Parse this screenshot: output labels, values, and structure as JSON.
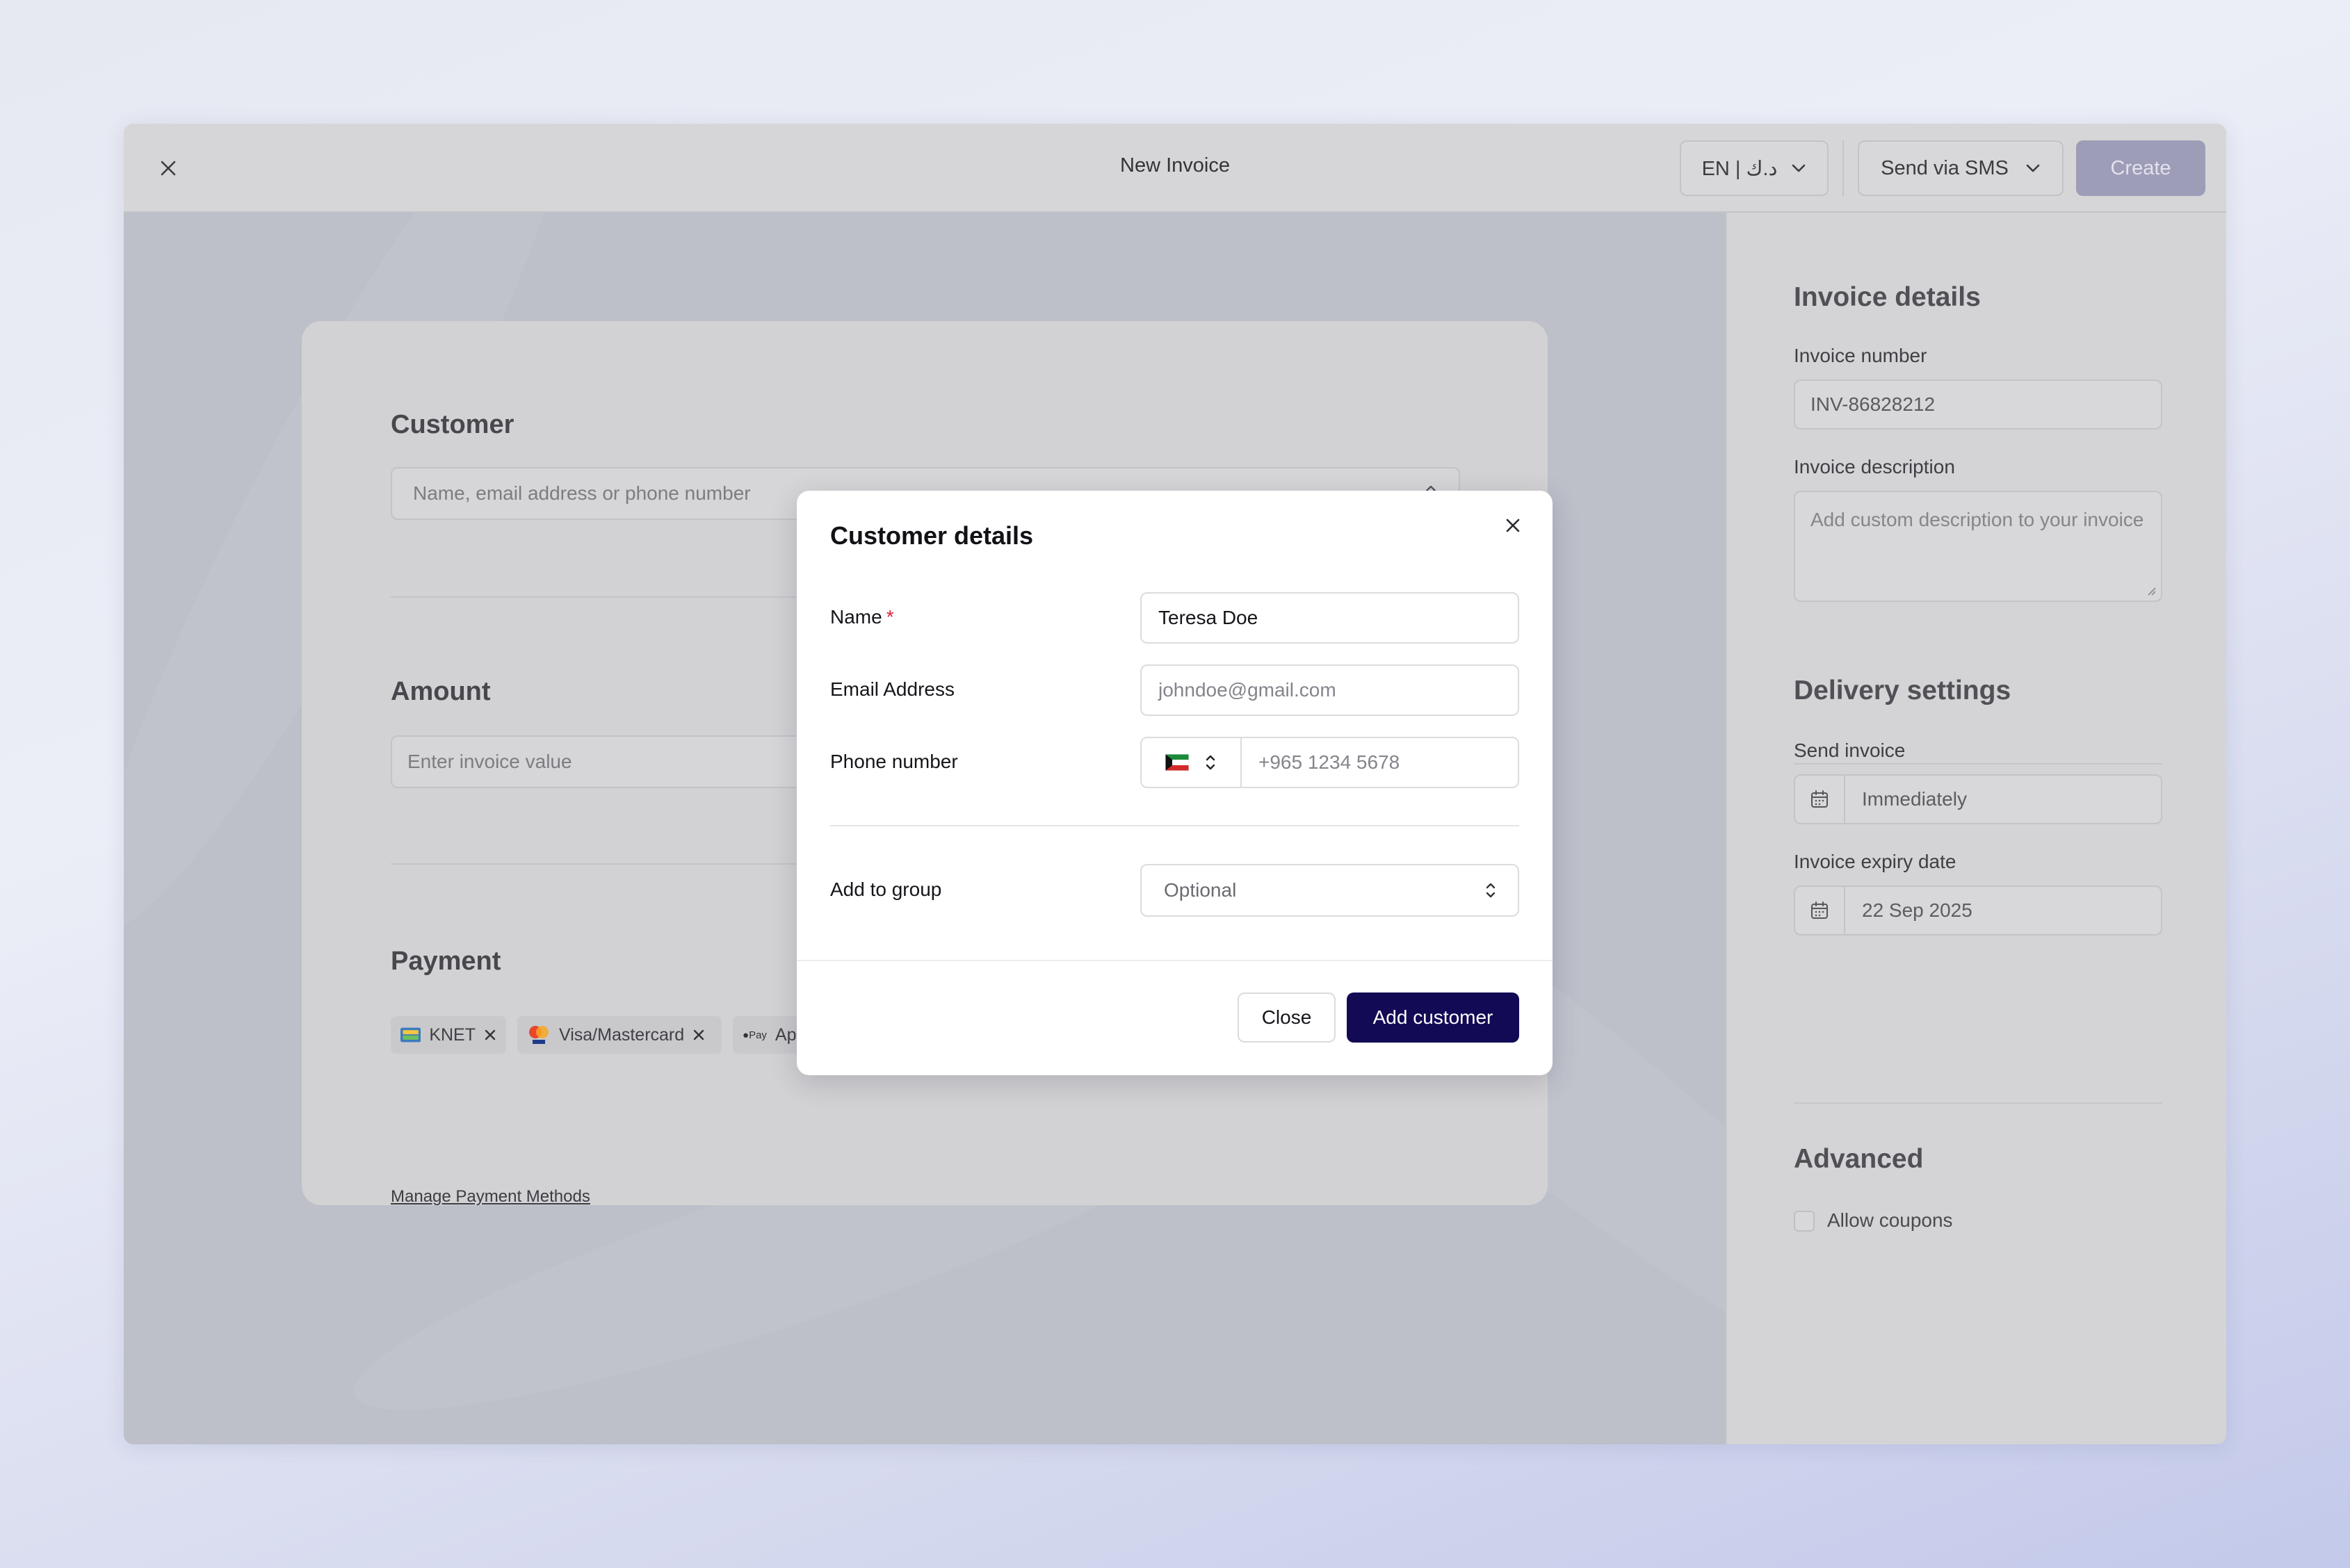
{
  "topbar": {
    "title": "New Invoice",
    "language": "EN | د.ك",
    "send_method": "Send via SMS",
    "create_label": "Create"
  },
  "invoice_form": {
    "customer": {
      "title": "Customer",
      "placeholder": "Name, email address or phone number"
    },
    "amount": {
      "title": "Amount",
      "placeholder": "Enter invoice value"
    },
    "payment": {
      "title": "Payment",
      "methods": [
        {
          "label": "KNET"
        },
        {
          "label": "Visa/Mastercard"
        },
        {
          "label": "App"
        }
      ],
      "apple_pay_mark": "Pay",
      "manage_link": "Manage Payment Methods"
    }
  },
  "right_panel": {
    "invoice_details": {
      "title": "Invoice details",
      "number_label": "Invoice number",
      "number_value": "INV-86828212",
      "description_label": "Invoice description",
      "description_placeholder": "Add custom description to your invoice"
    },
    "delivery": {
      "title": "Delivery settings",
      "send_label": "Send invoice",
      "send_value": "Immediately",
      "expiry_label": "Invoice expiry date",
      "expiry_value": "22 Sep 2025"
    },
    "advanced": {
      "title": "Advanced",
      "coupons_label": "Allow coupons",
      "coupons_checked": false
    }
  },
  "modal": {
    "title": "Customer details",
    "name_label": "Name",
    "required_mark": "*",
    "name_value": "Teresa Doe",
    "email_label": "Email Address",
    "email_placeholder": "johndoe@gmail.com",
    "phone_label": "Phone number",
    "phone_placeholder": "+965 1234 5678",
    "country": "kuwait-flag-icon",
    "group_label": "Add to group",
    "group_placeholder": "Optional",
    "close_label": "Close",
    "add_label": "Add customer"
  },
  "colors": {
    "primary_button": "#120a55",
    "required": "#d9253b",
    "create_disabled": "#9e9db7"
  }
}
